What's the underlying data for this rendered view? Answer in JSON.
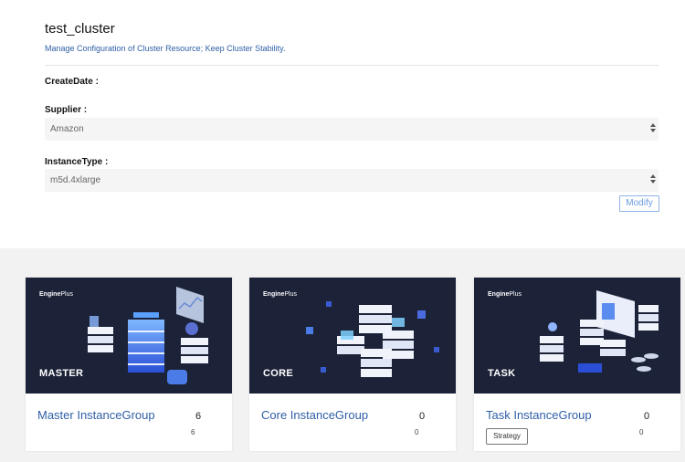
{
  "cluster": {
    "title": "test_cluster",
    "subtitle": "Manage Configuration of Cluster Resource; Keep Cluster Stability."
  },
  "form": {
    "create_date_label": "CreateDate :",
    "supplier_label": "Supplier :",
    "supplier_value": "Amazon",
    "instance_type_label": "InstanceType :",
    "instance_type_value": "m5d.4xlarge",
    "modify_label": "Modify"
  },
  "cards": [
    {
      "brand_a": "Engine",
      "brand_b": "Plus",
      "role": "MASTER",
      "name": "Master InstanceGroup",
      "count": "6",
      "sub_count": "6"
    },
    {
      "brand_a": "Engine",
      "brand_b": "Plus",
      "role": "CORE",
      "name": "Core InstanceGroup",
      "count": "0",
      "sub_count": "0"
    },
    {
      "brand_a": "Engine",
      "brand_b": "Plus",
      "role": "TASK",
      "name": "Task InstanceGroup",
      "count": "0",
      "sub_count": "0",
      "strategy_label": "Strategy"
    }
  ],
  "colors": {
    "accent": "#2f5fa6",
    "banner_bg": "#1c2338",
    "button_border": "#8fb3e6"
  }
}
